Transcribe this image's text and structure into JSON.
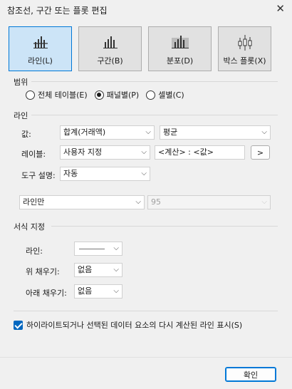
{
  "window": {
    "title": "참조선, 구간 또는 플롯 편집",
    "close_glyph": "✕"
  },
  "tabs": [
    {
      "label": "라인(L)",
      "icon": "line-chart-icon",
      "active": true
    },
    {
      "label": "구간(B)",
      "icon": "band-chart-icon",
      "active": false
    },
    {
      "label": "분포(D)",
      "icon": "distribution-chart-icon",
      "active": false
    },
    {
      "label": "박스 플롯(X)",
      "icon": "box-plot-icon",
      "active": false
    }
  ],
  "scope": {
    "label": "범위",
    "options": [
      {
        "label": "전체 테이블(E)",
        "selected": false
      },
      {
        "label": "패널별(P)",
        "selected": true
      },
      {
        "label": "셀별(C)",
        "selected": false
      }
    ]
  },
  "line": {
    "label": "라인",
    "value_label": "값:",
    "value_field": "합계(거래액)",
    "value_agg": "평균",
    "label_label": "레이블:",
    "label_type": "사용자 지정",
    "label_text": "<계산> : <값>",
    "label_insert_button": ">",
    "tooltip_label": "도구 설명:",
    "tooltip_value": "자동",
    "line_mode": "라인만",
    "confidence": "95"
  },
  "format": {
    "label": "서식 지정",
    "line_label": "라인:",
    "fill_above_label": "위 채우기:",
    "fill_above_value": "없음",
    "fill_below_label": "아래 채우기:",
    "fill_below_value": "없음"
  },
  "highlight": {
    "label": "하이라이트되거나 선택된 데이터 요소의 다시 계산된 라인 표시(S)",
    "checked": true
  },
  "footer": {
    "ok_label": "확인"
  },
  "colors": {
    "accent": "#0078d7",
    "active_tab": "#cce4f7",
    "checkbox": "#0067c0"
  }
}
